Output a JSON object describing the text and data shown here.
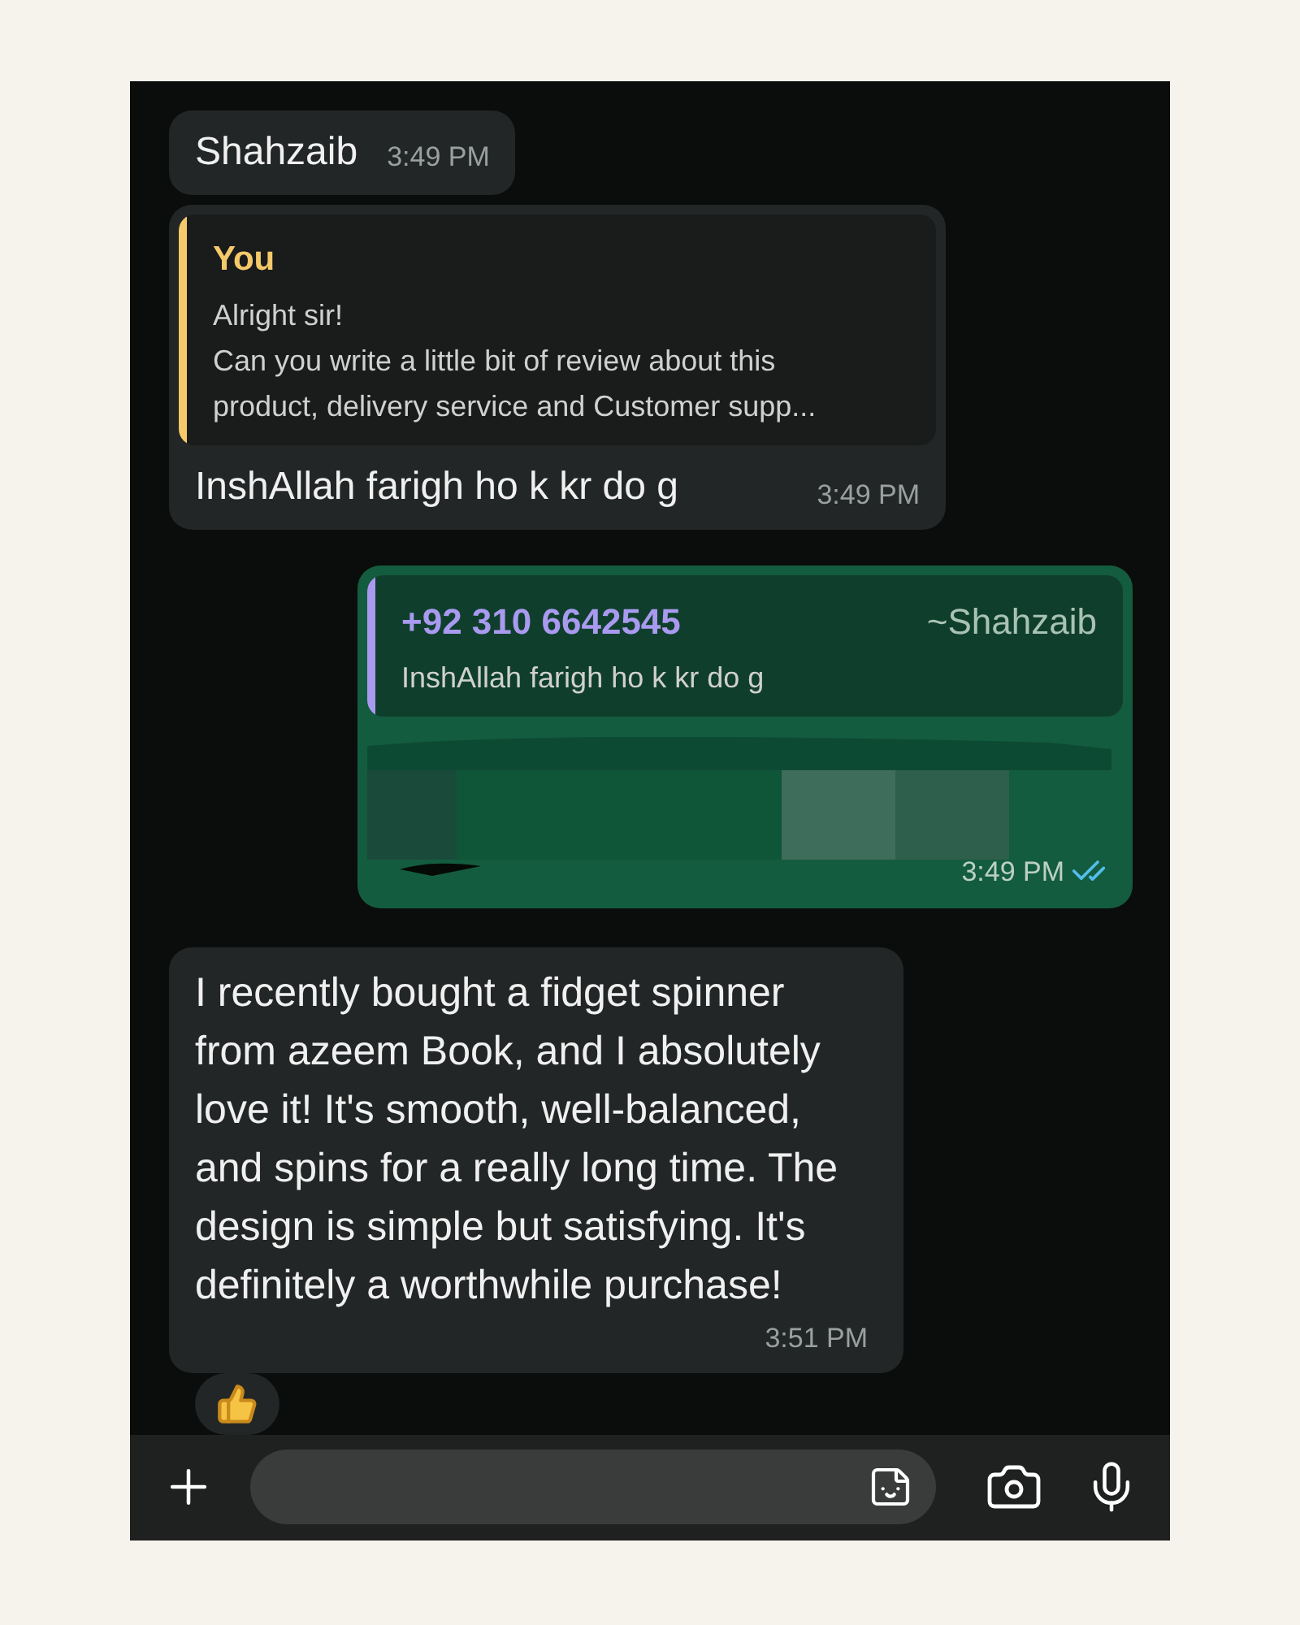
{
  "messages": [
    {
      "kind": "text",
      "sent": false,
      "text": "Shahzaib",
      "time": "3:49 PM"
    },
    {
      "kind": "reply",
      "sent": false,
      "quote": {
        "author": "You",
        "color": "#f5c96a",
        "lines": [
          "Alright sir!",
          "Can you write a little bit of review about this",
          "product, delivery service and Customer supp..."
        ]
      },
      "text": "InshAllah farigh ho k kr do g",
      "time": "3:49 PM"
    },
    {
      "kind": "reply",
      "sent": true,
      "quote": {
        "author": "+92 310 6642545",
        "alias": "~Shahzaib",
        "color": "#a99af0",
        "lines": [
          "InshAllah farigh ho k kr do g"
        ]
      },
      "redacted": true,
      "time": "3:49 PM",
      "read": true
    },
    {
      "kind": "text",
      "sent": false,
      "text": "I recently bought a fidget spinner from azeem Book, and I absolutely love it! It's smooth, well-balanced, and spins for a really long time. The design is simple but satisfying. It's definitely a worthwhile purchase!",
      "time": "3:51 PM",
      "reaction": true
    }
  ]
}
